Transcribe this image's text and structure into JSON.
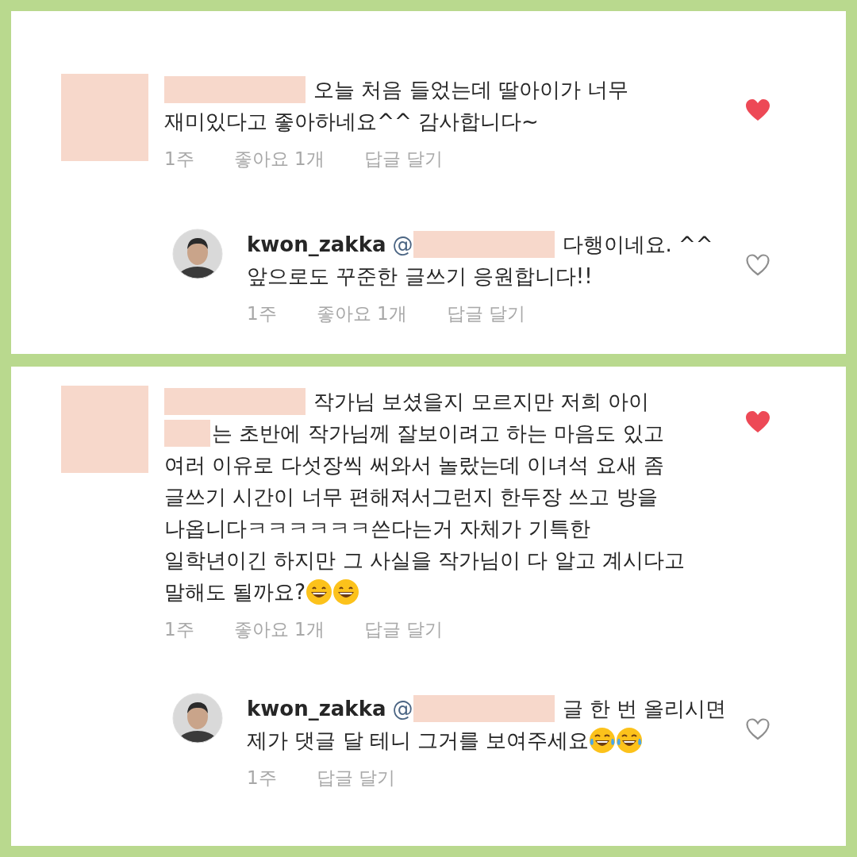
{
  "panels": [
    {
      "comments": [
        {
          "kind": "comment",
          "liked": true,
          "lines": [
            [
              {
                "kind": "redaction"
              },
              {
                "kind": "text",
                "text": "오늘 처음 들었는데 딸아이가 너무"
              }
            ],
            [
              {
                "kind": "text",
                "text": "재미있다고 좋아하네요^^ 감사합니다~"
              }
            ]
          ],
          "meta": {
            "time": "1주",
            "likes": "좋아요 1개",
            "reply": "답글 달기"
          }
        },
        {
          "kind": "reply",
          "liked": false,
          "username": "kwon_zakka",
          "lines": [
            [
              {
                "kind": "mention",
                "text": "@"
              },
              {
                "kind": "redaction"
              },
              {
                "kind": "text",
                "text": "다행이네요. ^^"
              }
            ],
            [
              {
                "kind": "text",
                "text": "앞으로도 꾸준한 글쓰기 응원합니다!!"
              }
            ]
          ],
          "meta": {
            "time": "1주",
            "likes": "좋아요 1개",
            "reply": "답글 달기"
          }
        }
      ]
    },
    {
      "comments": [
        {
          "kind": "comment",
          "liked": true,
          "lines": [
            [
              {
                "kind": "redaction"
              },
              {
                "kind": "text",
                "text": "작가님 보셨을지 모르지만 저희 아이"
              }
            ],
            [
              {
                "kind": "shortredaction"
              },
              {
                "kind": "text",
                "text": "는 초반에 작가님께 잘보이려고 하는 마음도 있고"
              }
            ],
            [
              {
                "kind": "text",
                "text": "여러 이유로 다섯장씩 써와서 놀랐는데 이녀석 요새 좀"
              }
            ],
            [
              {
                "kind": "text",
                "text": "글쓰기 시간이 너무 편해져서그런지 한두장 쓰고 방을"
              }
            ],
            [
              {
                "kind": "text",
                "text": "나옵니다ㅋㅋㅋㅋㅋㅋ쓴다는거 자체가 기특한"
              }
            ],
            [
              {
                "kind": "text",
                "text": "일학년이긴 하지만 그 사실을 작가님이 다 알고 계시다고"
              }
            ],
            [
              {
                "kind": "text",
                "text": "말해도 될까요?"
              },
              {
                "kind": "grin"
              },
              {
                "kind": "grin"
              }
            ]
          ],
          "meta": {
            "time": "1주",
            "likes": "좋아요 1개",
            "reply": "답글 달기"
          }
        },
        {
          "kind": "reply",
          "liked": false,
          "username": "kwon_zakka",
          "lines": [
            [
              {
                "kind": "mention",
                "text": "@"
              },
              {
                "kind": "redaction"
              },
              {
                "kind": "text",
                "text": "글 한 번 올리시면"
              }
            ],
            [
              {
                "kind": "text",
                "text": "제가 댓글 달 테니 그거를 보여주세요"
              },
              {
                "kind": "tearjoy"
              },
              {
                "kind": "tearjoy"
              }
            ]
          ],
          "meta": {
            "time": "1주",
            "reply": "답글 달기"
          }
        }
      ]
    }
  ]
}
